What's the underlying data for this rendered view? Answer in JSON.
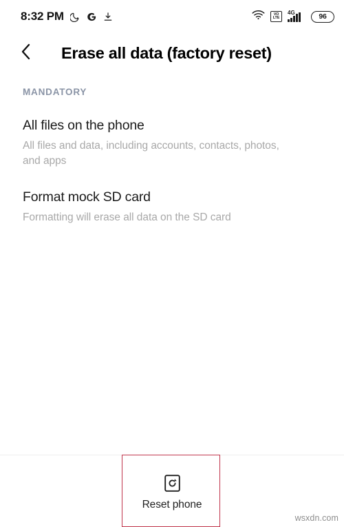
{
  "status_bar": {
    "time": "8:32 PM",
    "icons_left": [
      "moon-icon",
      "google-g-icon",
      "download-icon"
    ],
    "volte_line1": "VO",
    "volte_line2": "LTE",
    "network_type": "4G",
    "signal_bars": 5,
    "battery_percent": "96",
    "wifi": "wifi-icon"
  },
  "app_bar": {
    "back_icon": "back-chevron-icon",
    "title": "Erase all data (factory reset)"
  },
  "content": {
    "section_label": "MANDATORY",
    "items": [
      {
        "title": "All files on the phone",
        "subtitle": "All files and data, including accounts, contacts, photos, and apps"
      },
      {
        "title": "Format mock SD card",
        "subtitle": "Formatting will erase all data on the SD card"
      }
    ]
  },
  "bottom_bar": {
    "reset_icon": "reset-phone-icon",
    "reset_label": "Reset phone"
  },
  "annotation": {
    "highlight_color": "#c0344a"
  },
  "watermark": {
    "text": "wsxdn.com"
  }
}
